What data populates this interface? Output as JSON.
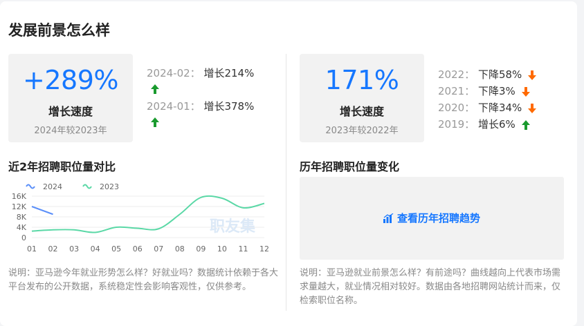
{
  "page": {
    "title": "发展前景怎么样"
  },
  "left_stat": {
    "value": "+289%",
    "label": "增长速度",
    "sub": "2024年较2023年"
  },
  "left_growth": [
    {
      "period": "2024-02：",
      "change": "增长214%",
      "direction": "up"
    },
    {
      "period": "2024-01：",
      "change": "增长378%",
      "direction": "up"
    }
  ],
  "right_stat": {
    "value": "171%",
    "label": "增长速度",
    "sub": "2023年较2022年"
  },
  "right_growth": [
    {
      "period": "2022：",
      "change": "下降58%",
      "direction": "down"
    },
    {
      "period": "2021：",
      "change": "下降3%",
      "direction": "down"
    },
    {
      "period": "2020：",
      "change": "下降34%",
      "direction": "down"
    },
    {
      "period": "2019：",
      "change": "增长6%",
      "direction": "up"
    }
  ],
  "left_section": {
    "title": "近2年招聘职位量对比"
  },
  "right_section": {
    "title": "历年招聘职位量变化",
    "link_label": "查看历年招聘趋势"
  },
  "watermark": "职友集",
  "colors": {
    "accent": "#1677ff",
    "up": "#1a9a2e",
    "down": "#ff6a00",
    "series_2024": "#5b8ff9",
    "series_2023": "#5ad8a6"
  },
  "chart_data": {
    "type": "line",
    "x": [
      "01",
      "02",
      "03",
      "04",
      "05",
      "06",
      "07",
      "08",
      "09",
      "10",
      "11",
      "12"
    ],
    "ylim": [
      0,
      16000
    ],
    "y_ticks": [
      "0",
      "4K",
      "8K",
      "12K",
      "16K"
    ],
    "y_tick_values": [
      0,
      4000,
      8000,
      12000,
      16000
    ],
    "legend": "top-left",
    "series": [
      {
        "name": "2024",
        "values": [
          12000,
          9000
        ]
      },
      {
        "name": "2023",
        "values": [
          2500,
          3000,
          3000,
          2000,
          4000,
          3600,
          3400,
          9000,
          15500,
          15200,
          11500,
          13200
        ]
      }
    ]
  },
  "notes": {
    "left": "说明：亚马逊今年就业形势怎么样？好就业吗？数据统计依赖于各大平台发布的公开数据，系统稳定性会影响客观性，仅供参考。",
    "right": "说明：亚马逊就业前景怎么样？有前途吗？曲线越向上代表市场需求量越大，就业情况相对较好。数据由各地招聘网站统计而来，仅检索职位名称。"
  }
}
